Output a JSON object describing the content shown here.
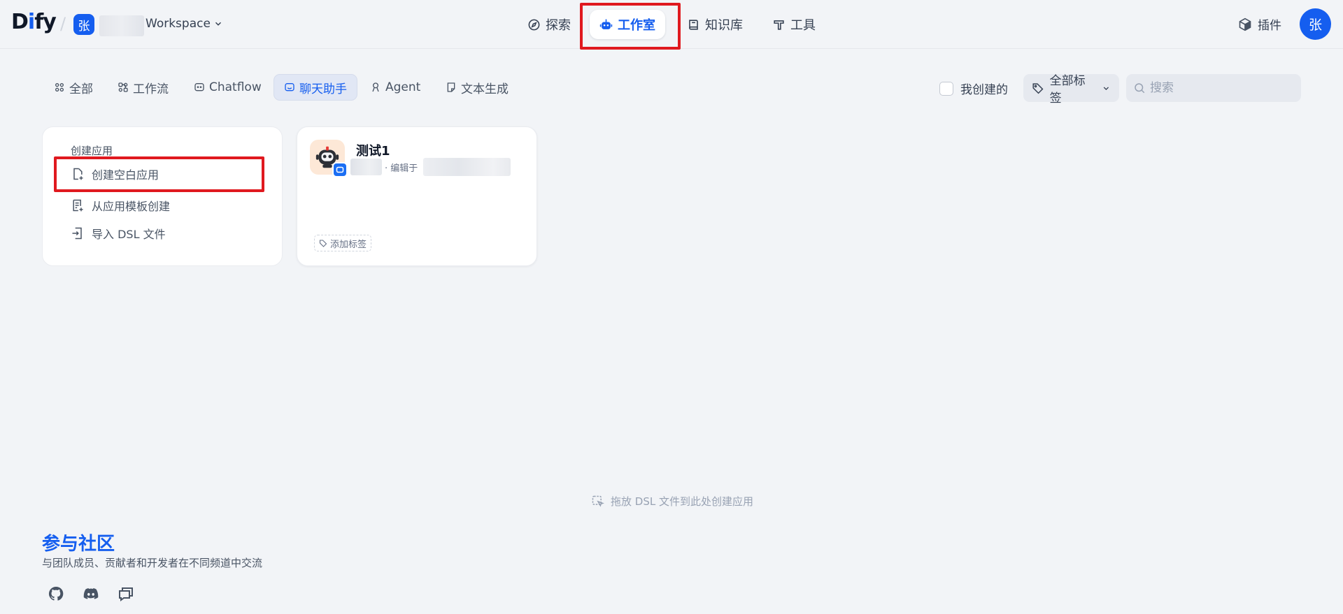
{
  "brand": {
    "logo": "Dify",
    "workspace_avatar": "张",
    "workspace_name": "Workspace"
  },
  "nav": {
    "explore": "探索",
    "studio": "工作室",
    "knowledge": "知识库",
    "tools": "工具",
    "plugins": "插件",
    "user_avatar": "张"
  },
  "filters": {
    "tabs": [
      "全部",
      "工作流",
      "Chatflow",
      "聊天助手",
      "Agent",
      "文本生成"
    ],
    "active_tab": "聊天助手",
    "mine_label": "我创建的",
    "tags_label": "全部标签",
    "search_placeholder": "搜索"
  },
  "create": {
    "title": "创建应用",
    "blank": "创建空白应用",
    "from_template": "从应用模板创建",
    "import_dsl": "导入 DSL 文件"
  },
  "apps": [
    {
      "name": "测试1",
      "edited_prefix": "· 编辑于",
      "add_tag": "添加标签"
    }
  ],
  "drop_hint": "拖放 DSL 文件到此处创建应用",
  "community": {
    "title": "参与社区",
    "desc": "与团队成员、贡献者和开发者在不同频道中交流"
  },
  "colors": {
    "accent": "#155eef",
    "highlight": "#e0191f",
    "background": "#f2f4f7"
  },
  "icons": [
    "compass-icon",
    "robot-icon",
    "book-icon",
    "hammer-icon",
    "cube-icon",
    "github-icon",
    "discord-icon",
    "forum-icon"
  ]
}
